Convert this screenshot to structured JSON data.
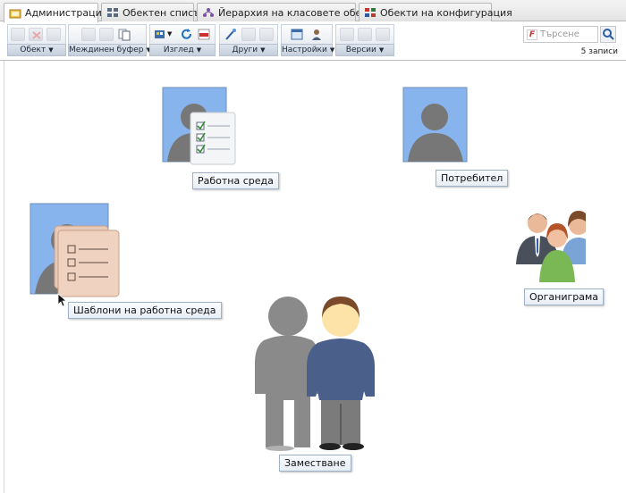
{
  "tabs": [
    {
      "label": "Администрация",
      "icon": "administration-icon",
      "active": true
    },
    {
      "label": "Обектен списък",
      "icon": "object-list-icon",
      "active": false
    },
    {
      "label": "Йерархия на класовете обекти",
      "icon": "hierarchy-icon",
      "active": false
    },
    {
      "label": "Обекти на конфигурация",
      "icon": "configuration-objects-icon",
      "active": false
    }
  ],
  "toolbar": {
    "groups": [
      {
        "label": "Обект"
      },
      {
        "label": "Междинен буфер"
      },
      {
        "label": "Изглед"
      },
      {
        "label": "Други"
      },
      {
        "label": "Настройки"
      },
      {
        "label": "Версии"
      }
    ],
    "search_placeholder": "Търсене",
    "records": "5 записи"
  },
  "nodes": [
    {
      "label": "Работна среда",
      "icon": "workspace-icon"
    },
    {
      "label": "Потребител",
      "icon": "user-icon"
    },
    {
      "label": "Шаблони на работна среда",
      "icon": "workspace-templates-icon"
    },
    {
      "label": "Органиграма",
      "icon": "org-chart-icon"
    },
    {
      "label": "Заместване",
      "icon": "substitution-icon"
    }
  ],
  "colors": {
    "accent": "#2f6fb8",
    "label_border": "#9fb1c6",
    "avatar_bg": "#8ab6ee"
  }
}
